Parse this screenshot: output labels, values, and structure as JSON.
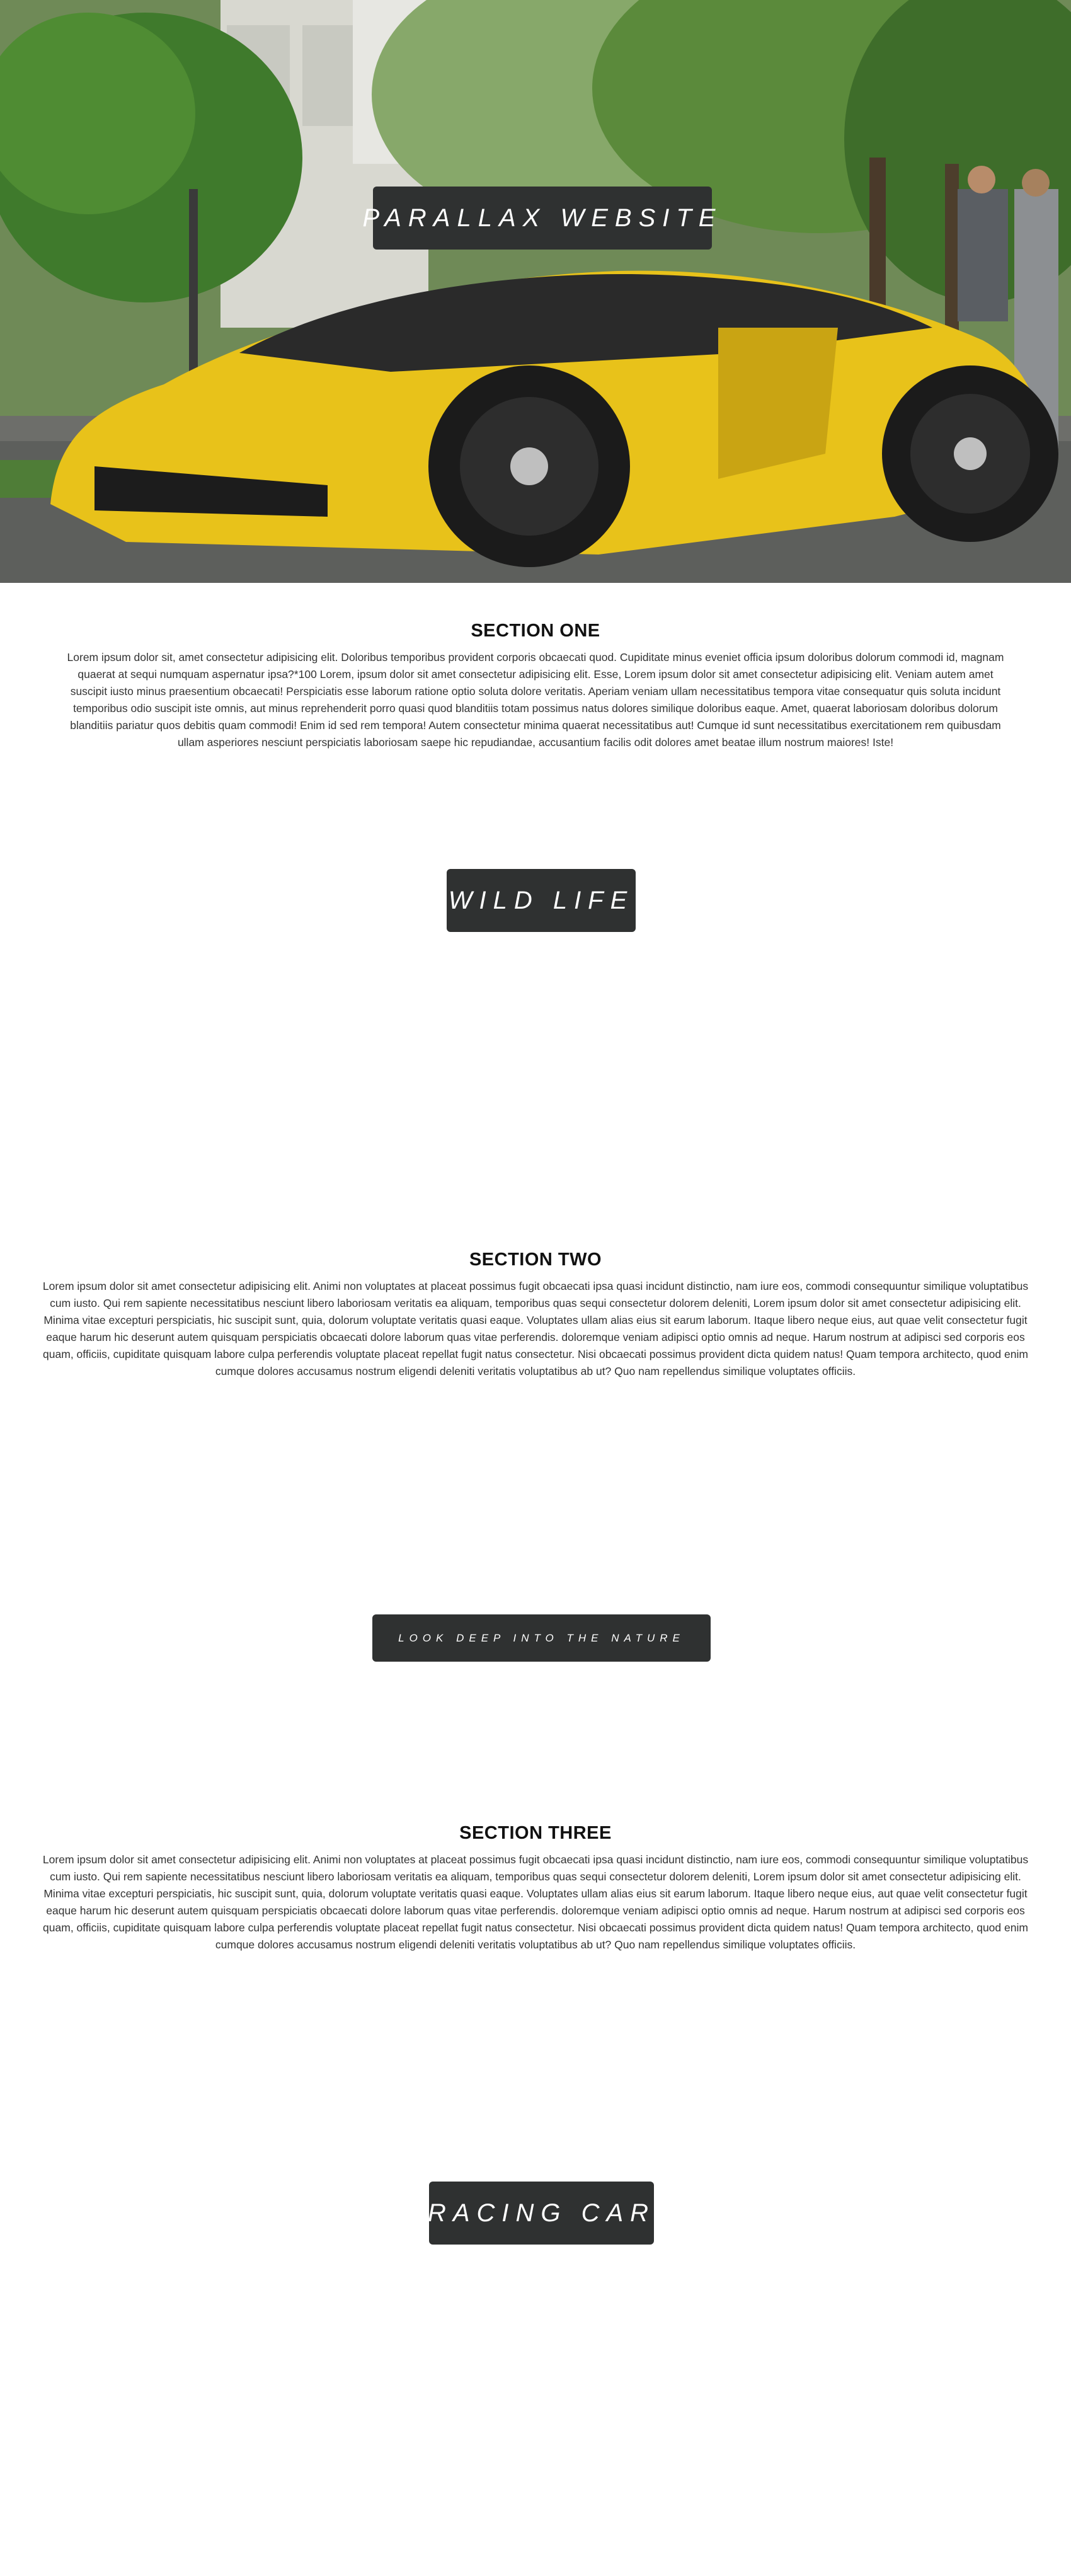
{
  "hero": {
    "title": "PARALLAX WEBSITE",
    "image": "yellow-sports-car-photo"
  },
  "sections": [
    {
      "heading": "SECTION ONE",
      "body": "Lorem ipsum dolor sit, amet consectetur adipisicing elit. Doloribus temporibus provident corporis obcaecati quod. Cupiditate minus eveniet officia ipsum doloribus dolorum commodi id, magnam quaerat at sequi numquam aspernatur ipsa?*100 Lorem, ipsum dolor sit amet consectetur adipisicing elit. Esse, Lorem ipsum dolor sit amet consectetur adipisicing elit. Veniam autem amet suscipit iusto minus praesentium obcaecati! Perspiciatis esse laborum ratione optio soluta dolore veritatis. Aperiam veniam ullam necessitatibus tempora vitae consequatur quis soluta incidunt temporibus odio suscipit iste omnis, aut minus reprehenderit porro quasi quod blanditiis totam possimus natus dolores similique doloribus eaque. Amet, quaerat laboriosam doloribus dolorum blanditiis pariatur quos debitis quam commodi! Enim id sed rem tempora! Autem consectetur minima quaerat necessitatibus aut! Cumque id sunt necessitatibus exercitationem rem quibusdam ullam asperiores nesciunt perspiciatis laboriosam saepe hic repudiandae, accusantium facilis odit dolores amet beatae illum nostrum maiores! Iste!"
    },
    {
      "heading": "SECTION TWO",
      "body": "Lorem ipsum dolor sit amet consectetur adipisicing elit. Animi non voluptates at placeat possimus fugit obcaecati ipsa quasi incidunt distinctio, nam iure eos, commodi consequuntur similique voluptatibus cum iusto. Qui rem sapiente necessitatibus nesciunt libero laboriosam veritatis ea aliquam, temporibus quas sequi consectetur dolorem deleniti, Lorem ipsum dolor sit amet consectetur adipisicing elit. Minima vitae excepturi perspiciatis, hic suscipit sunt, quia, dolorum voluptate veritatis quasi eaque. Voluptates ullam alias eius sit earum laborum. Itaque libero neque eius, aut quae velit consectetur fugit eaque harum hic deserunt autem quisquam perspiciatis obcaecati dolore laborum quas vitae perferendis. doloremque veniam adipisci optio omnis ad neque. Harum nostrum at adipisci sed corporis eos quam, officiis, cupiditate quisquam labore culpa perferendis voluptate placeat repellat fugit natus consectetur. Nisi obcaecati possimus provident dicta quidem natus! Quam tempora architecto, quod enim cumque dolores accusamus nostrum eligendi deleniti veritatis voluptatibus ab ut? Quo nam repellendus similique voluptates officiis."
    },
    {
      "heading": "SECTION THREE",
      "body": "Lorem ipsum dolor sit amet consectetur adipisicing elit. Animi non voluptates at placeat possimus fugit obcaecati ipsa quasi incidunt distinctio, nam iure eos, commodi consequuntur similique voluptatibus cum iusto. Qui rem sapiente necessitatibus nesciunt libero laboriosam veritatis ea aliquam, temporibus quas sequi consectetur dolorem deleniti, Lorem ipsum dolor sit amet consectetur adipisicing elit. Minima vitae excepturi perspiciatis, hic suscipit sunt, quia, dolorum voluptate veritatis quasi eaque. Voluptates ullam alias eius sit earum laborum. Itaque libero neque eius, aut quae velit consectetur fugit eaque harum hic deserunt autem quisquam perspiciatis obcaecati dolore laborum quas vitae perferendis. doloremque veniam adipisci optio omnis ad neque. Harum nostrum at adipisci sed corporis eos quam, officiis, cupiditate quisquam labore culpa perferendis voluptate placeat repellat fugit natus consectetur. Nisi obcaecati possimus provident dicta quidem natus! Quam tempora architecto, quod enim cumque dolores accusamus nostrum eligendi deleniti veritatis voluptatibus ab ut? Quo nam repellendus similique voluptates officiis."
    }
  ],
  "banners": {
    "wild_life": "WILD LIFE",
    "look_deep": "LOOK DEEP INTO THE NATURE",
    "racing_car": "RACING CAR"
  },
  "colors": {
    "badge_bg": "#2f3131",
    "badge_text": "#ffffff",
    "car_yellow": "#e8c21a",
    "heading": "#111111",
    "body_text": "#333333"
  }
}
